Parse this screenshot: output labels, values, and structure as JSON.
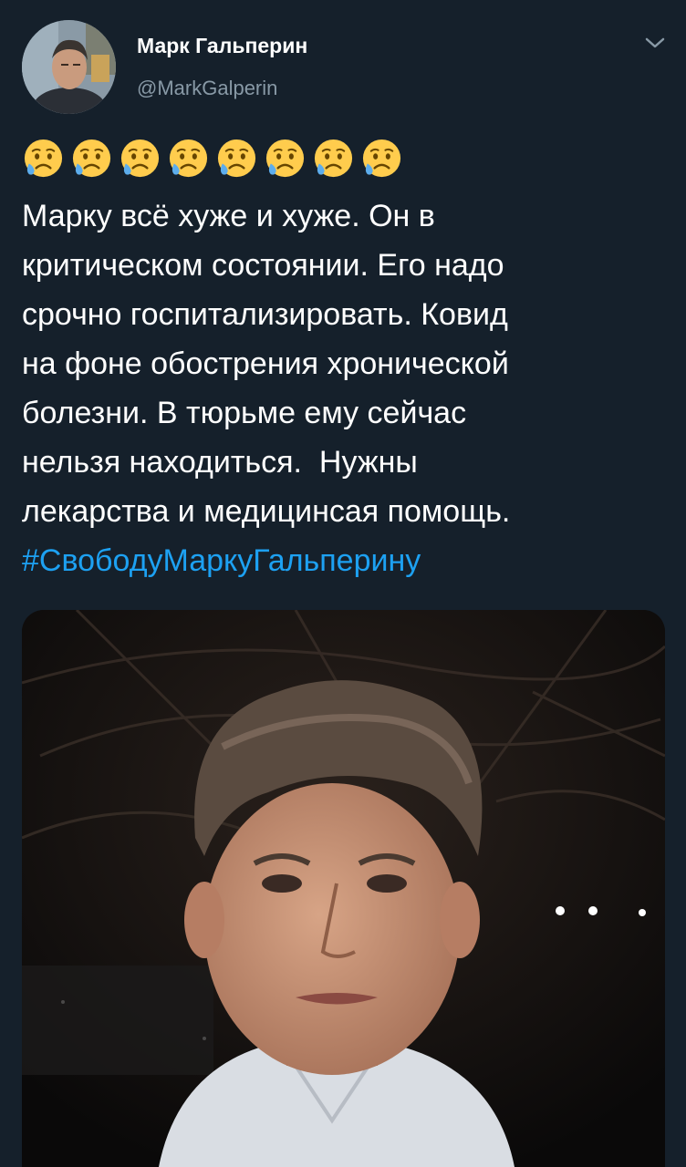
{
  "author": {
    "name": "Марк Гальперин",
    "handle": "@MarkGalperin"
  },
  "icons": {
    "avatar": "profile-photo",
    "menu": "chevron-down-icon",
    "emoji": "sad-but-relieved-face"
  },
  "emoji_count": 8,
  "tweet": {
    "lines": [
      "Марку всё хуже и хуже. Он в",
      "критическом состоянии. Его надо",
      "срочно госпитализировать. Ковид",
      "на фоне обострения хронической",
      "болезни. В тюрьме ему сейчас",
      "нельзя находиться.  Нужны",
      "лекарства и медицинсая помощь."
    ],
    "hashtag": "#СвободуМаркуГальперину"
  },
  "colors": {
    "background": "#15202b",
    "text": "#ffffff",
    "secondary": "#8899a6",
    "link": "#1da1f2"
  }
}
